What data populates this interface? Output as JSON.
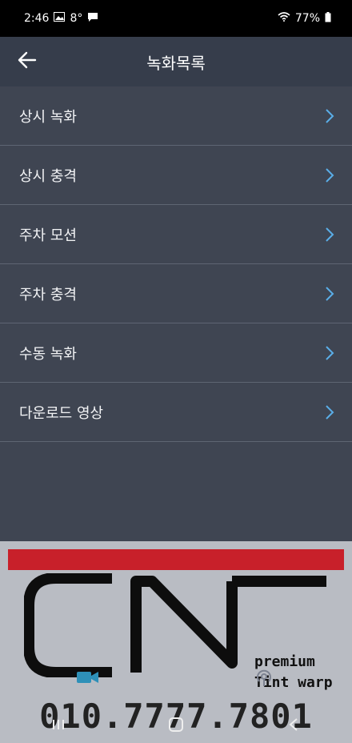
{
  "status_bar": {
    "time": "2:46",
    "temperature": "8°",
    "battery": "77%",
    "icons": [
      "image-icon",
      "message-icon",
      "wifi-icon",
      "battery-icon"
    ]
  },
  "header": {
    "title": "녹화목록",
    "back_icon": "arrow-left-icon"
  },
  "recording_list": {
    "items": [
      {
        "label": "상시 녹화"
      },
      {
        "label": "상시 충격"
      },
      {
        "label": "주차 모션"
      },
      {
        "label": "주차 충격"
      },
      {
        "label": "수동 녹화"
      },
      {
        "label": "다운로드 영상"
      }
    ],
    "chevron_icon": "chevron-right-icon",
    "chevron_color": "#5aaee8"
  },
  "watermark": {
    "logo_text": "CN",
    "tagline_line1": "premium",
    "tagline_line2": "Tint warp",
    "phone": "010.7777.7801",
    "accent_color": "#c8202a"
  },
  "bottom_tabs": {
    "icons": [
      "video-camera-icon",
      "broadcast-icon"
    ]
  },
  "navigation_bar": {
    "icons": [
      "recent-apps-icon",
      "home-icon",
      "back-icon"
    ]
  },
  "colors": {
    "background": "#3f4552",
    "header": "#363d4b",
    "divider": "#5e6573"
  }
}
